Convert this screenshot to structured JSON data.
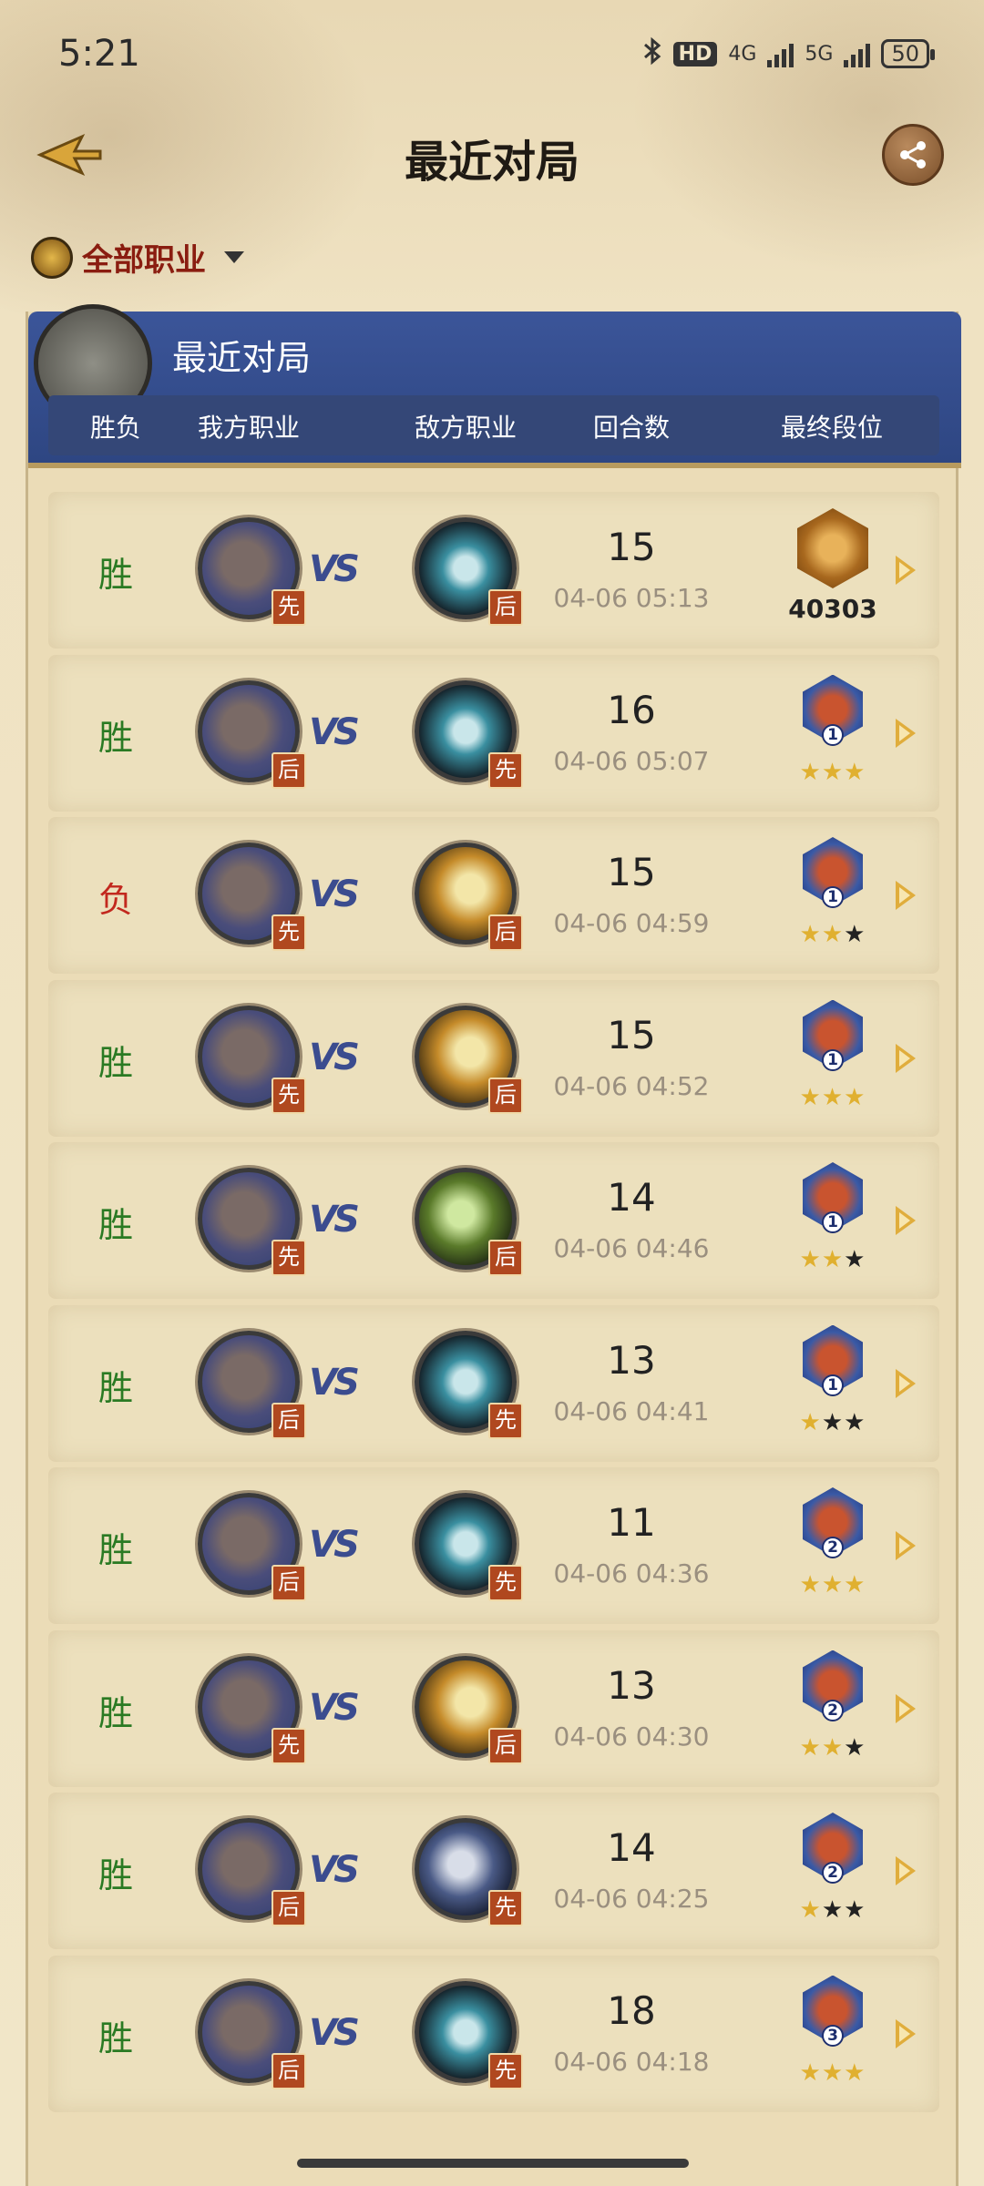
{
  "status": {
    "time": "5:21",
    "hd": "HD",
    "net1": "4G",
    "net2": "5G",
    "battery": "50"
  },
  "header": {
    "title": "最近对局"
  },
  "filter": {
    "label": "全部职业"
  },
  "panel": {
    "title": "最近对局",
    "columns": [
      "胜负",
      "我方职业",
      "敌方职业",
      "回合数",
      "最终段位"
    ]
  },
  "vs_text": "VS",
  "matches": [
    {
      "result": "胜",
      "outcome": "win",
      "my_class_icon": "mage-class-icon",
      "my_order": "先",
      "opponent_class_icon": "warrior-class-icon",
      "opp_order": "后",
      "turns": "15",
      "date": "04-06 05:13",
      "rank": "legend",
      "legend_rank": "40303",
      "stars": [
        "gold",
        "gold",
        "gold"
      ]
    },
    {
      "result": "胜",
      "outcome": "win",
      "my_class_icon": "mage-class-icon",
      "my_order": "后",
      "opponent_class_icon": "warrior-class-icon",
      "opp_order": "先",
      "turns": "16",
      "date": "04-06 05:07",
      "rank": "1",
      "stars": [
        "gold",
        "gold",
        "gold"
      ]
    },
    {
      "result": "负",
      "outcome": "loss",
      "my_class_icon": "mage-class-icon",
      "my_order": "先",
      "opponent_class_icon": "paladin-class-icon",
      "opp_order": "后",
      "turns": "15",
      "date": "04-06 04:59",
      "rank": "1",
      "stars": [
        "gold",
        "gold",
        "dark"
      ]
    },
    {
      "result": "胜",
      "outcome": "win",
      "my_class_icon": "mage-class-icon",
      "my_order": "先",
      "opponent_class_icon": "paladin-class-icon",
      "opp_order": "后",
      "turns": "15",
      "date": "04-06 04:52",
      "rank": "1",
      "stars": [
        "gold",
        "gold",
        "gold"
      ]
    },
    {
      "result": "胜",
      "outcome": "win",
      "my_class_icon": "mage-class-icon",
      "my_order": "先",
      "opponent_class_icon": "rogue-class-icon",
      "opp_order": "后",
      "turns": "14",
      "date": "04-06 04:46",
      "rank": "1",
      "stars": [
        "gold",
        "gold",
        "dark"
      ]
    },
    {
      "result": "胜",
      "outcome": "win",
      "my_class_icon": "mage-class-icon",
      "my_order": "后",
      "opponent_class_icon": "warrior-class-icon",
      "opp_order": "先",
      "turns": "13",
      "date": "04-06 04:41",
      "rank": "1",
      "stars": [
        "gold",
        "dark",
        "dark"
      ]
    },
    {
      "result": "胜",
      "outcome": "win",
      "my_class_icon": "mage-class-icon",
      "my_order": "后",
      "opponent_class_icon": "warrior-class-icon",
      "opp_order": "先",
      "turns": "11",
      "date": "04-06 04:36",
      "rank": "2",
      "stars": [
        "gold",
        "gold",
        "gold"
      ]
    },
    {
      "result": "胜",
      "outcome": "win",
      "my_class_icon": "mage-class-icon",
      "my_order": "先",
      "opponent_class_icon": "paladin-class-icon",
      "opp_order": "后",
      "turns": "13",
      "date": "04-06 04:30",
      "rank": "2",
      "stars": [
        "gold",
        "gold",
        "dark"
      ]
    },
    {
      "result": "胜",
      "outcome": "win",
      "my_class_icon": "mage-class-icon",
      "my_order": "后",
      "opponent_class_icon": "sword-class-icon",
      "opp_order": "先",
      "turns": "14",
      "date": "04-06 04:25",
      "rank": "2",
      "stars": [
        "gold",
        "dark",
        "dark"
      ]
    },
    {
      "result": "胜",
      "outcome": "win",
      "my_class_icon": "mage-class-icon",
      "my_order": "后",
      "opponent_class_icon": "warrior-class-icon",
      "opp_order": "先",
      "turns": "18",
      "date": "04-06 04:18",
      "rank": "3",
      "stars": [
        "gold",
        "gold",
        "gold"
      ]
    }
  ],
  "colors": {
    "win": "#2a7a23",
    "loss": "#c2281e",
    "header_blue": "#3b5599",
    "order_badge": "#b0481f",
    "gold_star": "#e0b030",
    "dark_star": "#222222"
  }
}
